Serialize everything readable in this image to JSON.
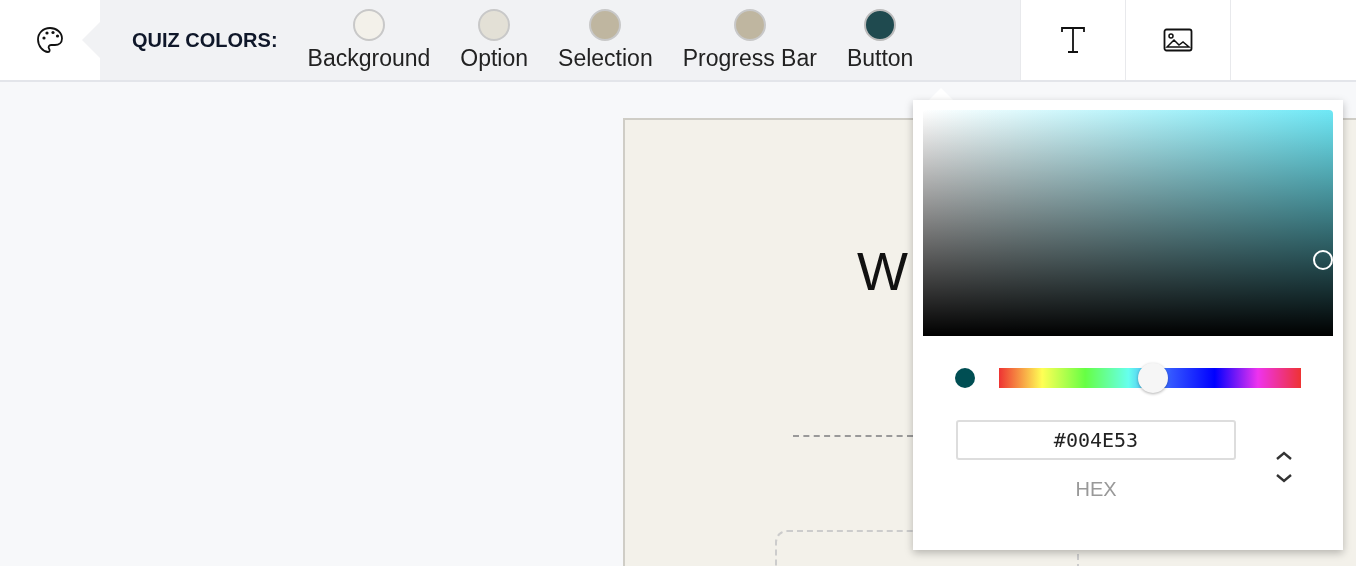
{
  "toolbar": {
    "title": "QUIZ COLORS:",
    "colors": [
      {
        "label": "Background",
        "color": "#f3f1ea",
        "selected": false
      },
      {
        "label": "Option",
        "color": "#e3e0d6",
        "selected": false
      },
      {
        "label": "Selection",
        "color": "#bfb6a0",
        "selected": false
      },
      {
        "label": "Progress Bar",
        "color": "#bfb6a0",
        "selected": false
      },
      {
        "label": "Button",
        "color": "#1f4a4f",
        "selected": true
      }
    ]
  },
  "preview": {
    "title_fragment": "W"
  },
  "color_picker": {
    "hue": {
      "level": 0.51
    },
    "value": "#004E53",
    "format": "HEX"
  }
}
